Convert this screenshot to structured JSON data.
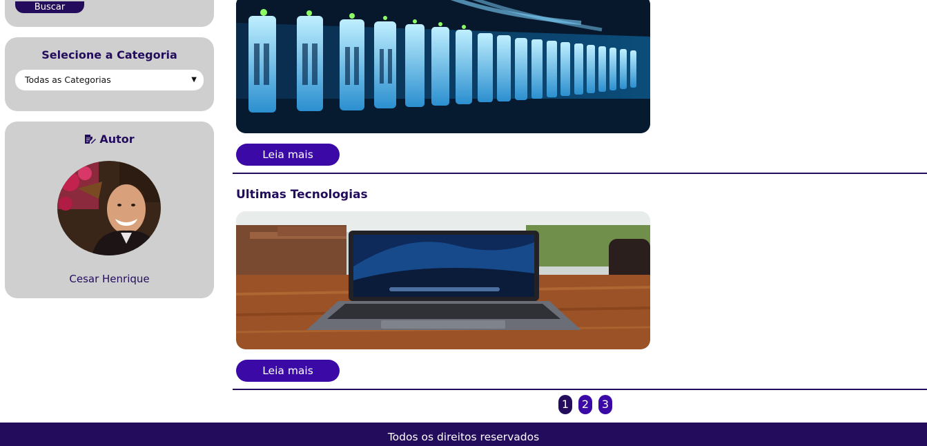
{
  "sidebar": {
    "search": {
      "button_label": "Buscar"
    },
    "category": {
      "title": "Selecione a Categoria",
      "selected": "Todas as Categorias"
    },
    "author": {
      "title": "Autor",
      "icon": "edit-document-icon",
      "name": "Cesar Henrique"
    }
  },
  "posts": [
    {
      "title": "",
      "image": "server-rack-photo",
      "read_more_label": "Leia mais"
    },
    {
      "title": "Ultimas Tecnologias",
      "image": "laptop-on-table-photo",
      "read_more_label": "Leia mais"
    }
  ],
  "pagination": {
    "pages": [
      "1",
      "2",
      "3"
    ],
    "active": "1"
  },
  "footer": {
    "text": "Todos os direitos reservados"
  },
  "colors": {
    "brand_dark": "#230c5c",
    "brand_accent": "#3b0aa6",
    "card_bg": "#cfcfcf"
  }
}
